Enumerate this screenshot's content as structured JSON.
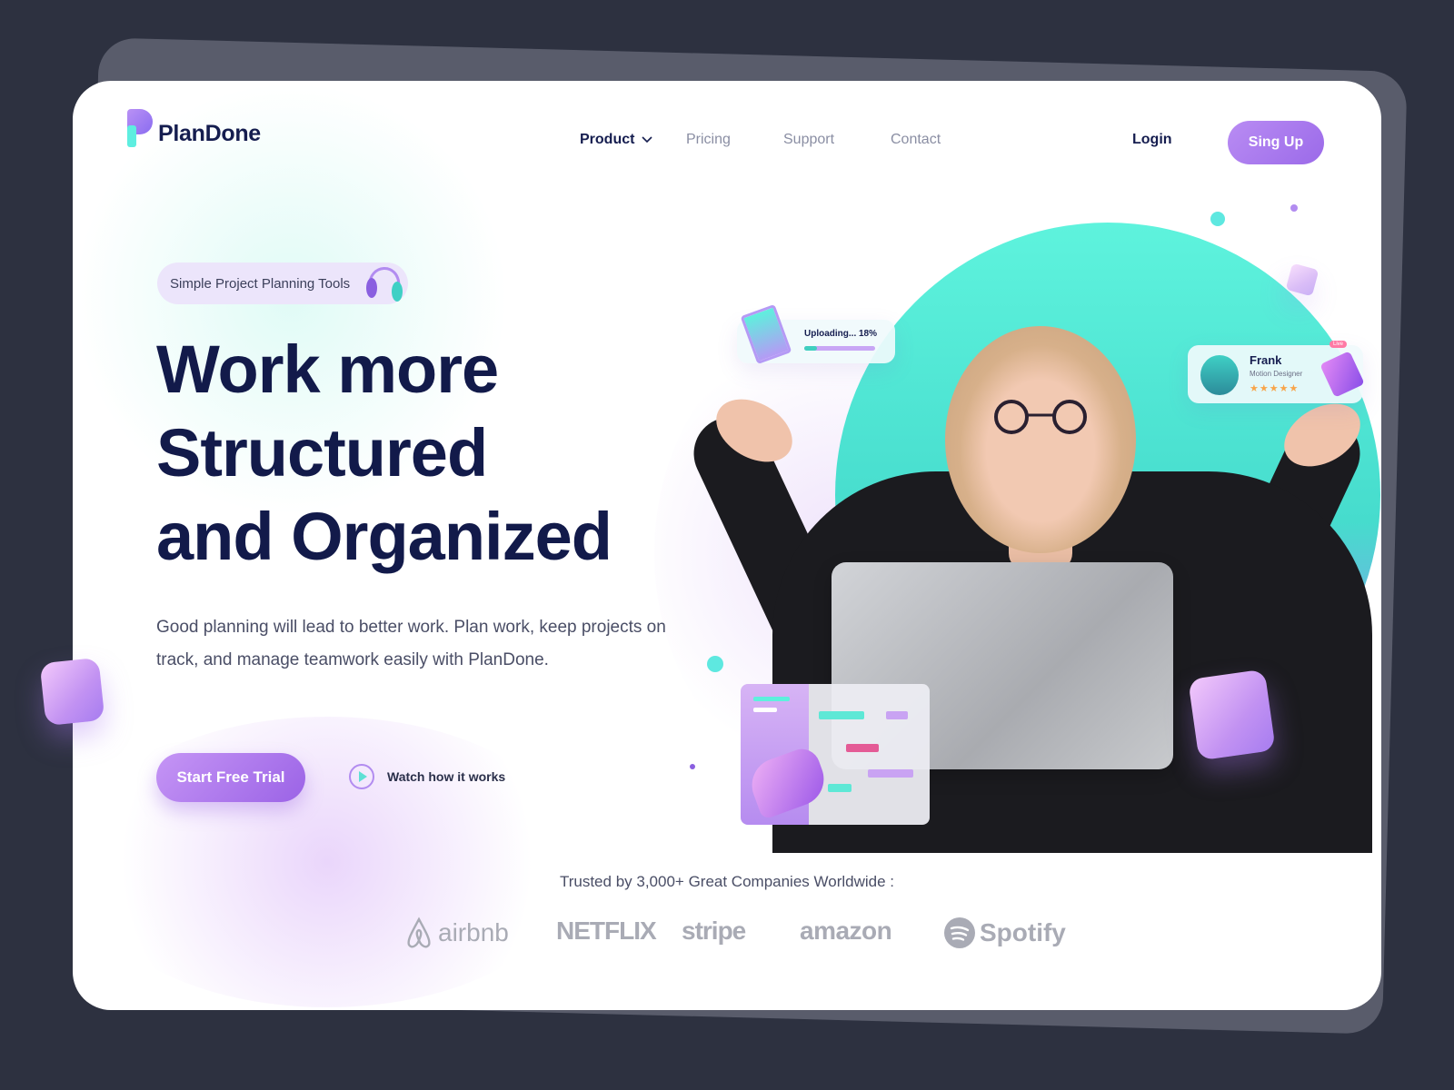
{
  "brand": {
    "name": "PlanDone"
  },
  "nav": {
    "items": [
      {
        "label": "Product",
        "active": true,
        "has_dropdown": true
      },
      {
        "label": "Pricing"
      },
      {
        "label": "Support"
      },
      {
        "label": "Contact"
      }
    ],
    "login": "Login",
    "signup": "Sing Up"
  },
  "hero": {
    "badge": "Simple Project Planning Tools",
    "headline": [
      "Work more",
      "Structured",
      "and Organized"
    ],
    "description": "Good planning will lead to better work. Plan work, keep projects on track, and manage teamwork easily with PlanDone.",
    "cta": "Start Free Trial",
    "watch": "Watch how it works"
  },
  "widgets": {
    "upload": {
      "label": "Uploading... 18%",
      "progress": 18
    },
    "profile": {
      "name": "Frank",
      "role": "Motion Designer",
      "rating": 5,
      "rating_stars": "★★★★★",
      "live": "Live"
    }
  },
  "trusted": {
    "text": "Trusted by 3,000+ Great Companies Worldwide :",
    "logos": [
      "airbnb",
      "NETFLIX",
      "stripe",
      "amazon",
      "Spotify"
    ]
  },
  "colors": {
    "accent": "#9b6ae9",
    "teal": "#4fe3d3",
    "navy": "#121a4a",
    "background": "#2d3140"
  }
}
